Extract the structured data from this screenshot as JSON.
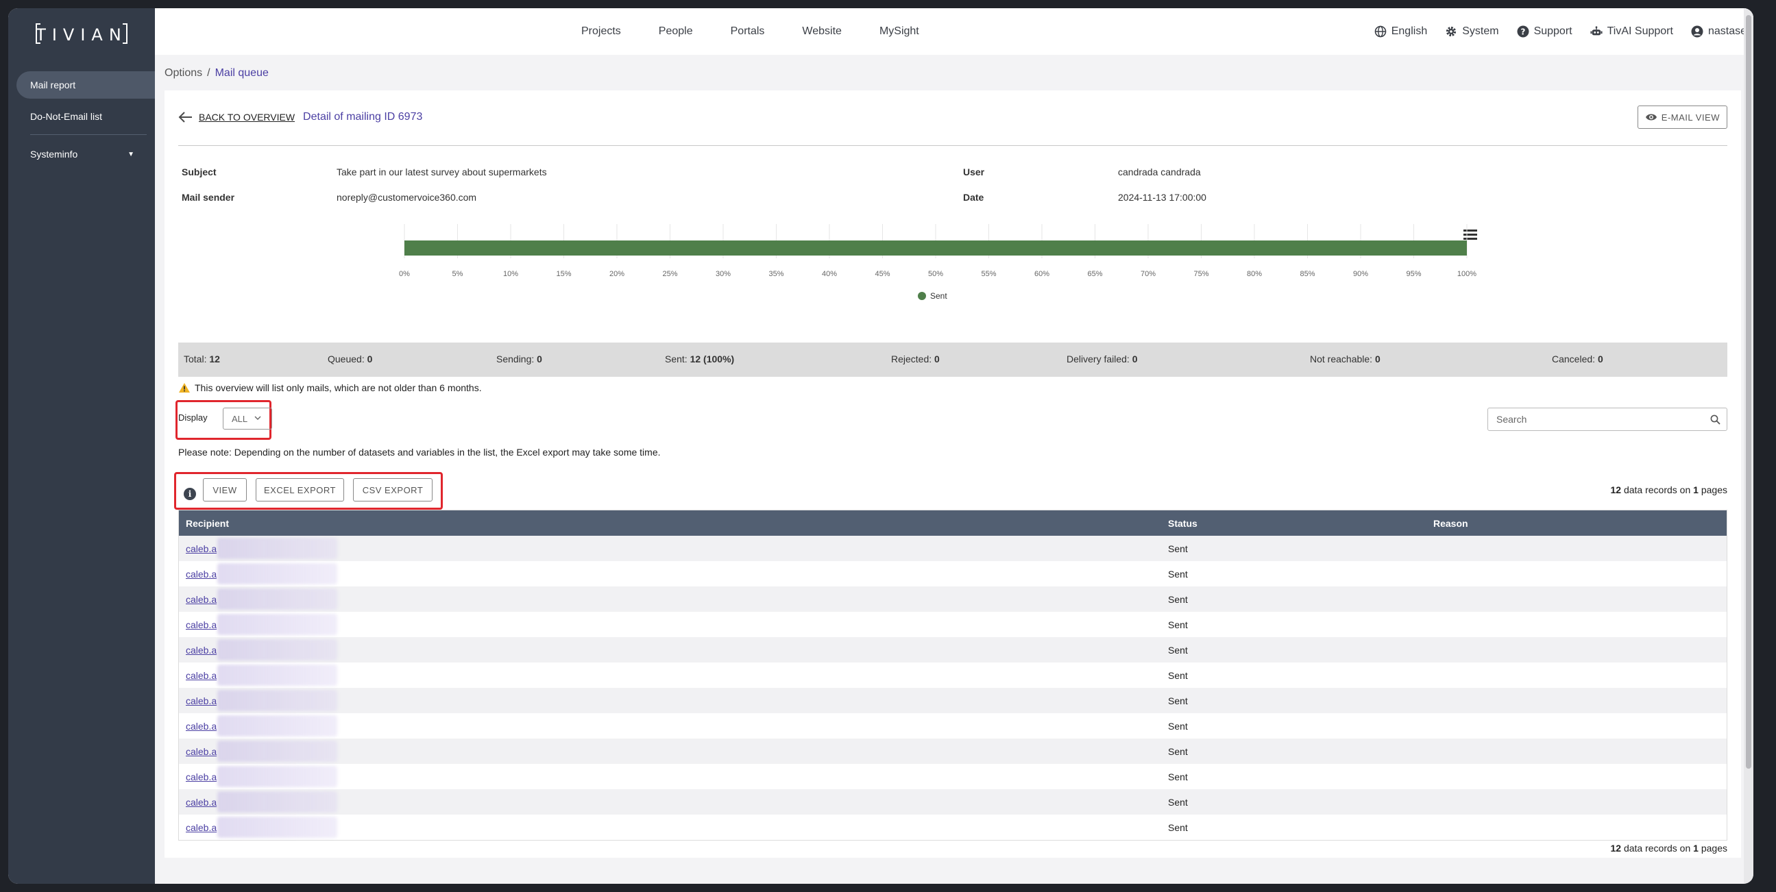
{
  "brand": {
    "logo_text": "TIVIAN"
  },
  "sidebar": {
    "items": [
      {
        "label": "Mail report"
      },
      {
        "label": "Do-Not-Email list"
      },
      {
        "label": "Systeminfo"
      }
    ]
  },
  "topnav": {
    "links": [
      "Projects",
      "People",
      "Portals",
      "Website",
      "MySight"
    ],
    "right": {
      "language": "English",
      "system": "System",
      "support": "Support",
      "tivai": "TivAI Support",
      "user": "nastase"
    }
  },
  "breadcrumb": {
    "root": "Options",
    "sep": "/",
    "current": "Mail queue"
  },
  "header": {
    "back_label": "BACK TO OVERVIEW",
    "title": "Detail of mailing ID 6973",
    "email_view_label": "E-MAIL VIEW"
  },
  "meta": {
    "subject_label": "Subject",
    "subject": "Take part in our latest survey about supermarkets",
    "sender_label": "Mail sender",
    "sender": "noreply@customervoice360.com",
    "user_label": "User",
    "user": "candrada candrada",
    "date_label": "Date",
    "date": "2024-11-13 17:00:00"
  },
  "chart_data": {
    "type": "bar",
    "orientation": "horizontal",
    "stacked": "percent",
    "categories": [
      ""
    ],
    "series": [
      {
        "name": "Sent",
        "values": [
          100
        ],
        "color": "#4f7f4a"
      }
    ],
    "xlim": [
      0,
      100
    ],
    "xticks": [
      "0%",
      "5%",
      "10%",
      "15%",
      "20%",
      "25%",
      "30%",
      "35%",
      "40%",
      "45%",
      "50%",
      "55%",
      "60%",
      "65%",
      "70%",
      "75%",
      "80%",
      "85%",
      "90%",
      "95%",
      "100%"
    ],
    "grid": true,
    "legend": "bottom-center"
  },
  "summary": {
    "total_label": "Total:",
    "total": "12",
    "queued_label": "Queued:",
    "queued": "0",
    "sending_label": "Sending:",
    "sending": "0",
    "sent_label": "Sent:",
    "sent": "12 (100%)",
    "rejected_label": "Rejected:",
    "rejected": "0",
    "failed_label": "Delivery failed:",
    "failed": "0",
    "unreachable_label": "Not reachable:",
    "unreachable": "0",
    "canceled_label": "Canceled:",
    "canceled": "0"
  },
  "warning": "This overview will list only mails, which are not older than 6 months.",
  "display": {
    "label": "Display",
    "value": "ALL"
  },
  "search": {
    "placeholder": "Search"
  },
  "note": "Please note: Depending on the number of datasets and variables in the list, the Excel export may take some time.",
  "actions": {
    "view": "VIEW",
    "excel": "EXCEL EXPORT",
    "csv": "CSV EXPORT"
  },
  "records": {
    "count": "12",
    "mid": "data records on",
    "pages": "1",
    "suffix": "pages"
  },
  "table": {
    "headers": {
      "recipient": "Recipient",
      "status": "Status",
      "reason": "Reason"
    },
    "rows": [
      {
        "recipient": "caleb.a",
        "status": "Sent"
      },
      {
        "recipient": "caleb.a",
        "status": "Sent"
      },
      {
        "recipient": "caleb.a",
        "status": "Sent"
      },
      {
        "recipient": "caleb.a",
        "status": "Sent"
      },
      {
        "recipient": "caleb.a",
        "status": "Sent"
      },
      {
        "recipient": "caleb.a",
        "status": "Sent"
      },
      {
        "recipient": "caleb.a",
        "status": "Sent"
      },
      {
        "recipient": "caleb.a",
        "status": "Sent"
      },
      {
        "recipient": "caleb.a",
        "status": "Sent"
      },
      {
        "recipient": "caleb.a",
        "status": "Sent"
      },
      {
        "recipient": "caleb.a",
        "status": "Sent"
      },
      {
        "recipient": "caleb.a",
        "status": "Sent"
      }
    ]
  }
}
